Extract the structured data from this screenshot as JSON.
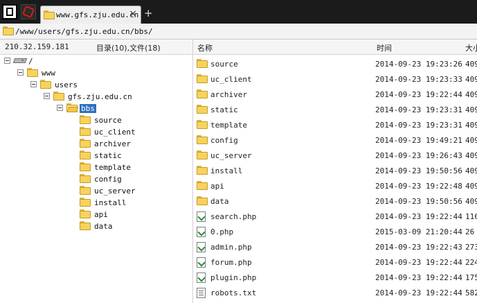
{
  "tab": {
    "title": "www.gfs.zju.edu.cn",
    "close": "×",
    "new_tab": "+"
  },
  "address": {
    "path": "/www/users/gfs.zju.edu.cn/bbs/"
  },
  "header": {
    "ip": "210.32.159.181",
    "counts": "目录(10),文件(18)",
    "col_name": "名称",
    "col_time": "时间",
    "col_size": "大小"
  },
  "tree": {
    "root": "/",
    "www": "www",
    "users": "users",
    "site": "gfs.zju.edu.cn",
    "bbs": "bbs",
    "children": [
      "source",
      "uc_client",
      "archiver",
      "static",
      "template",
      "config",
      "uc_server",
      "install",
      "api",
      "data"
    ]
  },
  "files": [
    {
      "name": "source",
      "type": "folder",
      "time": "2014-09-23 19:23:26",
      "size": "409"
    },
    {
      "name": "uc_client",
      "type": "folder",
      "time": "2014-09-23 19:23:33",
      "size": "409"
    },
    {
      "name": "archiver",
      "type": "folder",
      "time": "2014-09-23 19:22:44",
      "size": "409"
    },
    {
      "name": "static",
      "type": "folder",
      "time": "2014-09-23 19:23:31",
      "size": "409"
    },
    {
      "name": "template",
      "type": "folder",
      "time": "2014-09-23 19:23:31",
      "size": "409"
    },
    {
      "name": "config",
      "type": "folder",
      "time": "2014-09-23 19:49:21",
      "size": "409"
    },
    {
      "name": "uc_server",
      "type": "folder",
      "time": "2014-09-23 19:26:43",
      "size": "409"
    },
    {
      "name": "install",
      "type": "folder",
      "time": "2014-09-23 19:50:56",
      "size": "409"
    },
    {
      "name": "api",
      "type": "folder",
      "time": "2014-09-23 19:22:48",
      "size": "409"
    },
    {
      "name": "data",
      "type": "folder",
      "time": "2014-09-23 19:50:56",
      "size": "409"
    },
    {
      "name": "search.php",
      "type": "php",
      "time": "2014-09-23 19:22:44",
      "size": "116"
    },
    {
      "name": "0.php",
      "type": "php",
      "time": "2015-03-09 21:20:44",
      "size": "26"
    },
    {
      "name": "admin.php",
      "type": "php",
      "time": "2014-09-23 19:22:43",
      "size": "273"
    },
    {
      "name": "forum.php",
      "type": "php",
      "time": "2014-09-23 19:22:44",
      "size": "224"
    },
    {
      "name": "plugin.php",
      "type": "php",
      "time": "2014-09-23 19:22:44",
      "size": "175"
    },
    {
      "name": "robots.txt",
      "type": "txt",
      "time": "2014-09-23 19:22:44",
      "size": "582"
    }
  ],
  "icons": {
    "folder": "folder-icon",
    "open_folder": "open-folder-icon",
    "drive": "drive-icon",
    "php": "php-file-icon",
    "txt": "text-file-icon"
  }
}
